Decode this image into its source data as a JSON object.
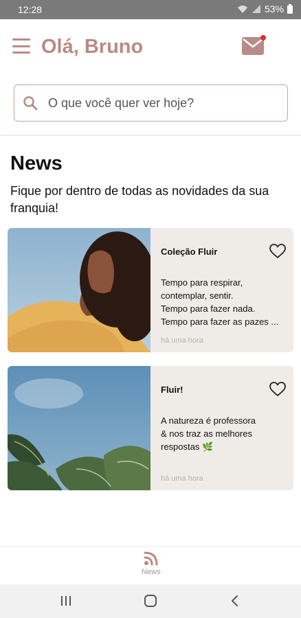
{
  "status_bar": {
    "time": "12:28",
    "battery": "53%"
  },
  "header": {
    "greeting": "Olá, Bruno"
  },
  "search": {
    "placeholder": "O que você quer ver hoje?"
  },
  "news": {
    "title": "News",
    "subtitle": "Fique por dentro de todas as novidades da sua franquia!"
  },
  "cards": [
    {
      "title": "Coleção Fluir",
      "text": "Tempo para respirar,\ncontemplar, sentir.\nTempo para fazer nada.\nTempo para fazer as pazes ...",
      "time": "há uma hora"
    },
    {
      "title": "Fluir!",
      "text": "A natureza é professora\n& nos traz as melhores\nrespostas 🌿",
      "time": "há uma hora"
    }
  ],
  "bottom_nav": {
    "items": [
      {
        "label": "News",
        "icon": "rss-icon"
      }
    ]
  },
  "colors": {
    "accent": "#b98a86",
    "notification": "#e12c2c",
    "card_bg": "#efece8"
  }
}
